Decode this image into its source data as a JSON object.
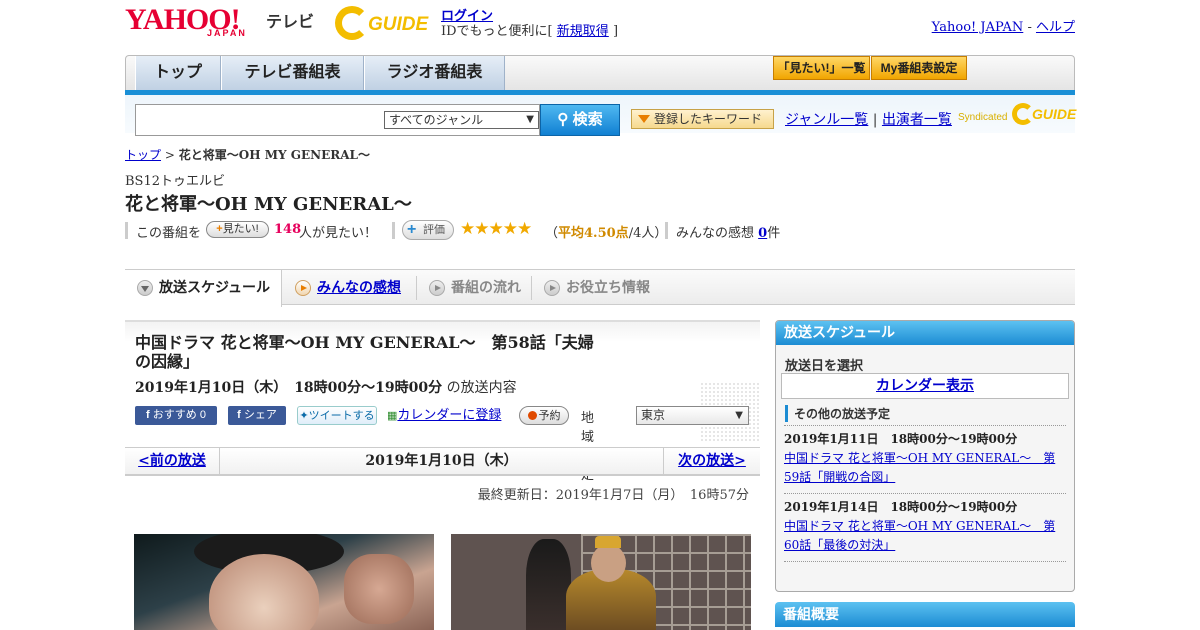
{
  "header": {
    "logo_yahoo": "YAHOO!",
    "logo_japan": "JAPAN",
    "logo_tv": "テレビ",
    "logo_guide": "GUIDE",
    "login": "ログイン",
    "login_sub_prefix": "IDでもっと便利に[",
    "signup": "新規取得",
    "login_sub_suffix": "]",
    "yahoo_japan_link": "Yahoo! JAPAN",
    "separator": "-",
    "help_link": "ヘルプ"
  },
  "nav": {
    "tabs": [
      "トップ",
      "テレビ番組表",
      "ラジオ番組表"
    ],
    "want_list": "「見たい!」一覧",
    "my_schedule": "My番組表設定"
  },
  "search": {
    "genre_selected": "すべてのジャンル",
    "button": "検索",
    "registered_keywords": "登録したキーワード",
    "genre_list": "ジャンル一覧",
    "link_sep": "|",
    "performer_list": "出演者一覧",
    "syndicated": "Syndicated"
  },
  "breadcrumb": {
    "home": "トップ",
    "sep": ">",
    "current": "花と将軍～OH MY GENERAL～"
  },
  "program": {
    "channel": "BS12トゥエルビ",
    "title": "花と将軍～OH MY GENERAL～",
    "this_program": "この番組を",
    "want_button": "見たい!",
    "want_count": "148",
    "want_suffix": "人が見たい！",
    "eval_button": "評価",
    "stars": "★★★★★",
    "rating_open": "（",
    "rating_avg": "平均4.50点",
    "rating_count": "/4人）",
    "impressions_label": "みんなの感想",
    "impressions_count": "0",
    "impressions_suffix": "件"
  },
  "tabs": {
    "schedule": "放送スケジュール",
    "impressions": "みんなの感想",
    "flow": "番組の流れ",
    "info": "お役立ち情報"
  },
  "episode": {
    "title": "中国ドラマ 花と将軍～OH MY GENERAL～　第58話「夫婦の因縁」",
    "datetime": "2019年1月10日（木）　18時00分～19時00分",
    "datetime_suffix": "の放送内容",
    "recommend": "おすすめ 0",
    "share": "シェア",
    "tweet": "ツイートする",
    "calendar_register": "カレンダーに登録",
    "reserve": "予約",
    "region_label": "地域設定",
    "region_selected": "東京"
  },
  "pager": {
    "prev": "<前の放送",
    "current": "2019年1月10日（木）",
    "next": "次の放送>"
  },
  "updated": "最終更新日：2019年1月7日（月）　16時57分",
  "sidebar": {
    "header": "放送スケジュール",
    "select_date": "放送日を選択",
    "calendar": "カレンダー表示",
    "other_header": "その他の放送予定",
    "items": [
      {
        "datetime": "2019年1月11日　18時00分～19時00分",
        "title": "中国ドラマ 花と将軍～OH MY GENERAL～　第59話「開戦の合図」"
      },
      {
        "datetime": "2019年1月14日　18時00分～19時00分",
        "title": "中国ドラマ 花と将軍～OH MY GENERAL～　第60話「最後の対決」"
      }
    ],
    "overview_header": "番組概要"
  },
  "colors": {
    "accent_blue": "#1a8fd6",
    "yahoo_red": "#e60033",
    "guide_yellow": "#f3bd00",
    "want_pink": "#e6005c",
    "rating_orange": "#d08a00"
  }
}
